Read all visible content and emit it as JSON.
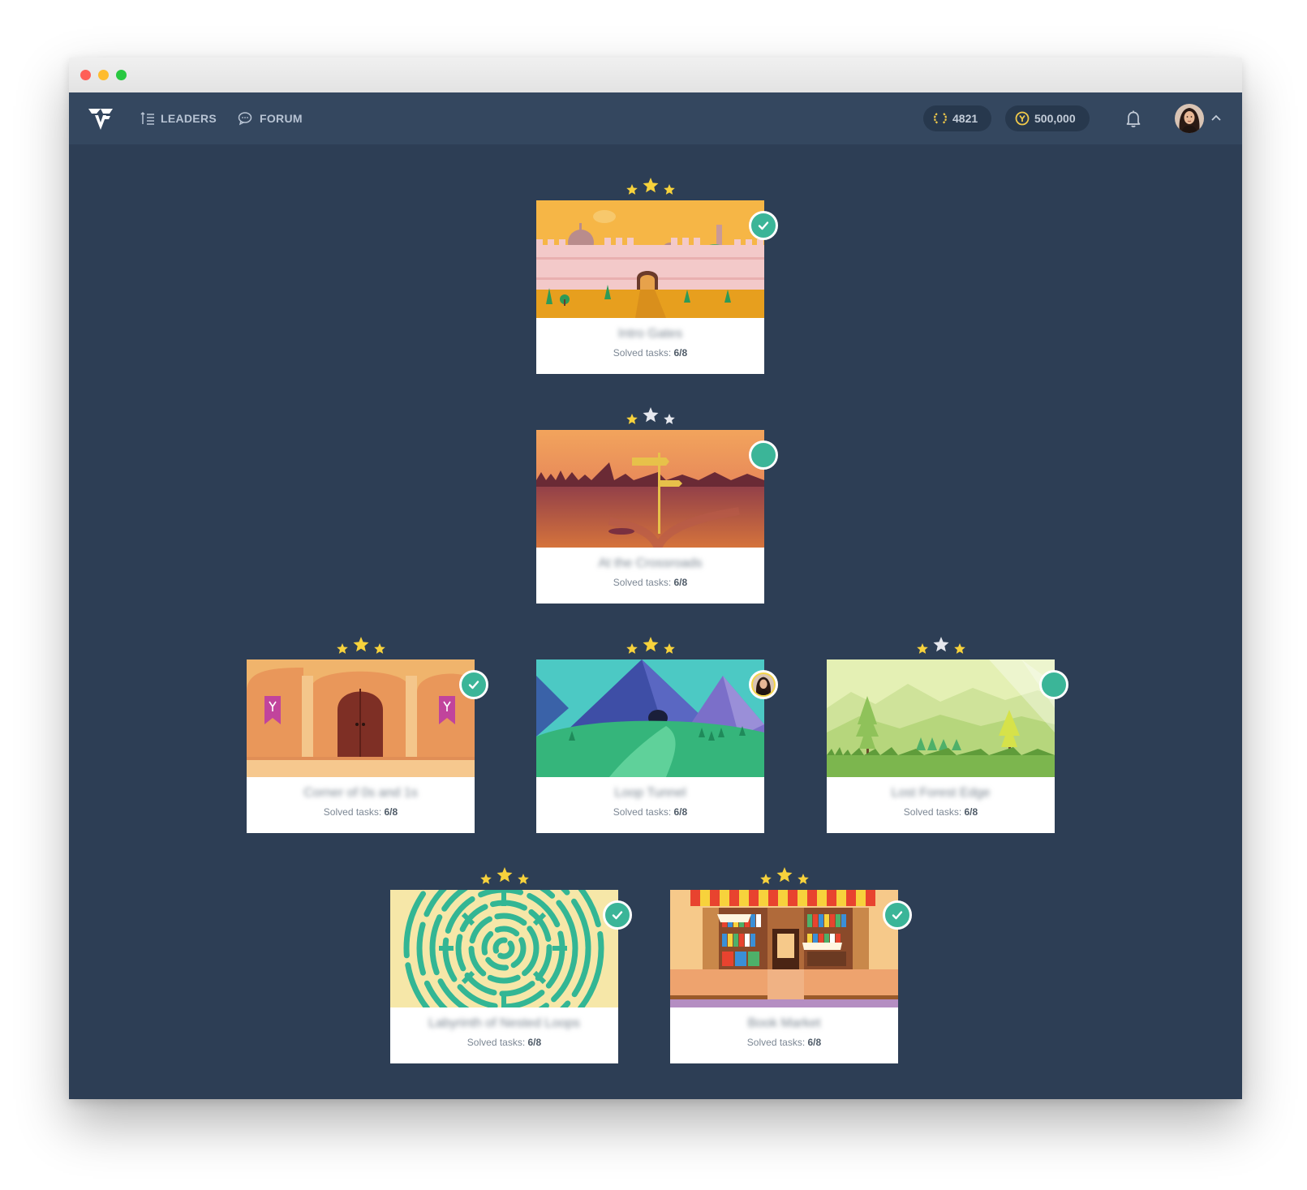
{
  "nav": {
    "leaders_label": "LEADERS",
    "forum_label": "FORUM",
    "points": "4821",
    "coins": "500,000"
  },
  "solved_prefix": "Solved tasks: ",
  "levels": [
    {
      "name": "Intro Gates",
      "solved": "6/8",
      "stars": 3,
      "status": "completed"
    },
    {
      "name": "At the Crossroads",
      "solved": "6/8",
      "stars": 1,
      "status": "available"
    },
    {
      "name": "Corner of 0s and 1s",
      "solved": "6/8",
      "stars": 3,
      "status": "completed"
    },
    {
      "name": "Loop Tunnel",
      "solved": "6/8",
      "stars": 3,
      "status": "current-user"
    },
    {
      "name": "Lost Forest Edge",
      "solved": "6/8",
      "stars": 2,
      "status": "available"
    },
    {
      "name": "Labyrinth of Nested Loops",
      "solved": "6/8",
      "stars": 3,
      "status": "completed"
    },
    {
      "name": "Book Market",
      "solved": "6/8",
      "stars": 3,
      "status": "completed"
    }
  ],
  "colors": {
    "background": "#2d3e55",
    "nav": "#34475f",
    "badge": "#3bb598",
    "star_on": "#f7d23c",
    "star_off": "#e6e8ee"
  }
}
